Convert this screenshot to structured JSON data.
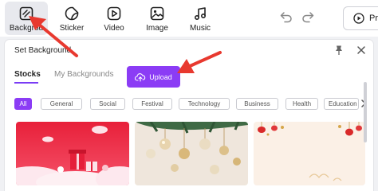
{
  "toolbar": {
    "items": [
      {
        "label": "Backgrou",
        "icon": "background-icon",
        "active": true
      },
      {
        "label": "Sticker",
        "icon": "sticker-icon"
      },
      {
        "label": "Video",
        "icon": "video-icon"
      },
      {
        "label": "Image",
        "icon": "image-icon"
      },
      {
        "label": "Music",
        "icon": "music-icon"
      }
    ],
    "preview_label": "Pr"
  },
  "panel": {
    "title": "Set Background",
    "tabs": [
      {
        "label": "Stocks",
        "selected": true
      },
      {
        "label": "My Backgrounds",
        "selected": false
      }
    ],
    "upload_label": "Upload",
    "categories": [
      "All",
      "General",
      "Social",
      "Festival",
      "Technology",
      "Business",
      "Health",
      "Education"
    ],
    "active_category": "All",
    "thumbnails": [
      {
        "theme": "red-gifts"
      },
      {
        "theme": "gold-ornaments"
      },
      {
        "theme": "chinese-lanterns"
      }
    ]
  },
  "colors": {
    "accent": "#8b3cf5",
    "annotation_arrow": "#e8392f"
  }
}
